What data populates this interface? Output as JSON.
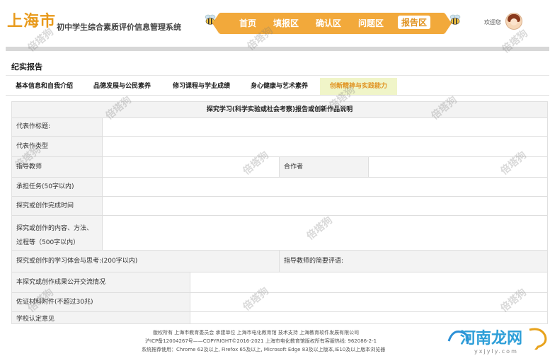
{
  "header": {
    "city": "上海市",
    "system_name": "初中学生综合素质评价信息管理系统",
    "welcome": "欢迎您"
  },
  "nav": {
    "items": [
      {
        "label": "首页"
      },
      {
        "label": "填报区"
      },
      {
        "label": "确认区"
      },
      {
        "label": "问题区"
      },
      {
        "label": "报告区"
      }
    ],
    "active": "报告区"
  },
  "page": {
    "title": "纪实报告"
  },
  "tabs": [
    {
      "label": "基本信息和自我介绍"
    },
    {
      "label": "品德发展与公民素养"
    },
    {
      "label": "修习课程与学业成绩"
    },
    {
      "label": "身心健康与艺术素养"
    },
    {
      "label": "创新精神与实践能力"
    }
  ],
  "form": {
    "title": "探究学习(科学实验或社会考察)报告或创新作品说明",
    "fields": {
      "work_title": "代表作标题:",
      "work_type": "代表作类型",
      "advisor": "指导教师",
      "collaborator": "合作者",
      "task": "承担任务(50字以内)",
      "completion_time": "探究或创作完成时间",
      "content_line1": "探究或创作的内容、方法、",
      "content_line2": "过程等（500字以内）",
      "reflection": "探究或创作的学习体会与思考:(200字以内)",
      "advisor_comment": "指导教师的简要评语:",
      "exchange": "本探究或创作成果公开交流情况",
      "attachments": "佐证材料附件(不超过30兆)",
      "school_opinion": "学校认定意见"
    }
  },
  "footer": {
    "line1": "版权所有  上海市教育委员会      承建单位  上海市电化教育馆      技术支持  上海教育软件发展有限公司",
    "line2": "沪ICP备12004267号——COPYRIGHT©2016-2021  上海市电化教育馆版权所有客服热线:  962086-2-1",
    "line3": "系统推荐使用：Chrome 62及以上, Firefox 65及以上, Microsoft Edge 83及以上版本,IE10及以上版本浏览器"
  },
  "watermark": {
    "text": "倍塔狗"
  },
  "corner_brand": {
    "text": "河南龙网",
    "url_text": "yxjyly.com"
  },
  "colors": {
    "brand_orange": "#f2a93b",
    "active_tab_bg": "#f0f5c8",
    "active_tab_text": "#e0921f",
    "city_text": "#e89a1c"
  }
}
